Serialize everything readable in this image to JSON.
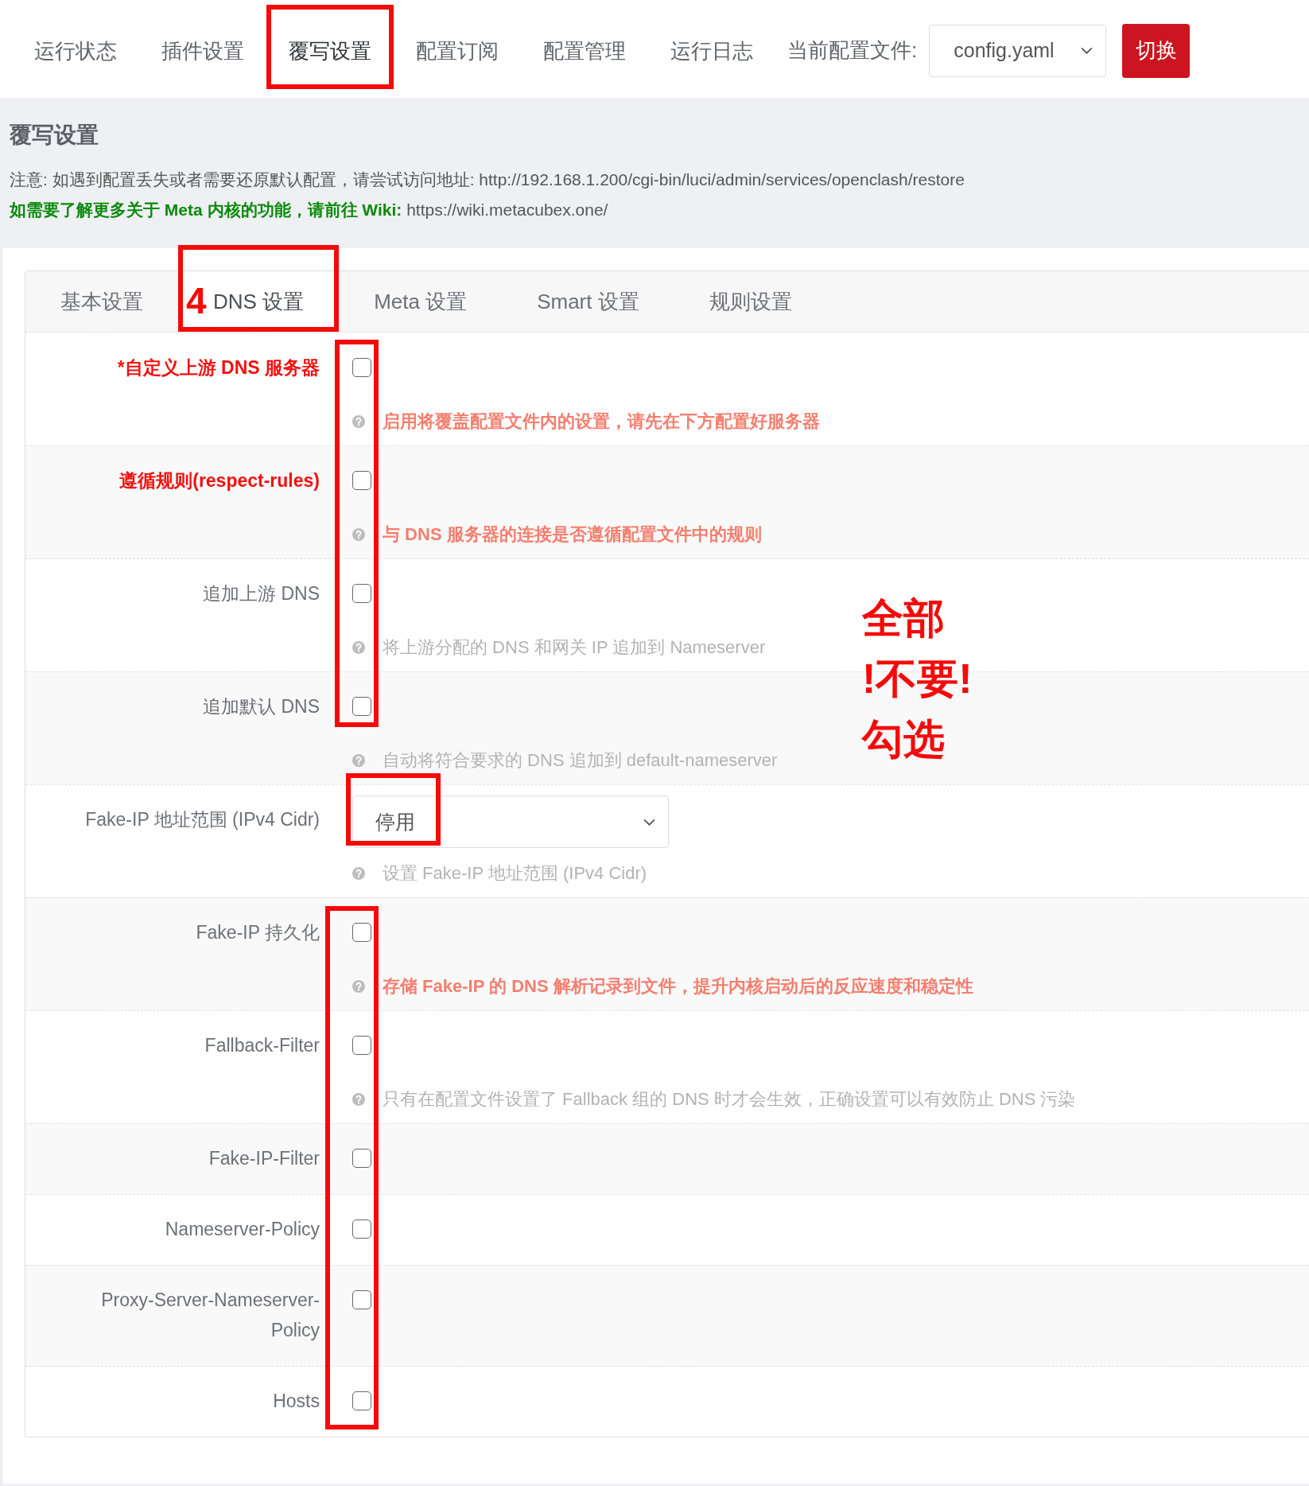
{
  "nav": {
    "tabs": [
      {
        "label": "运行状态",
        "selected": false
      },
      {
        "label": "插件设置",
        "selected": false
      },
      {
        "label": "覆写设置",
        "selected": true
      },
      {
        "label": "配置订阅",
        "selected": false
      },
      {
        "label": "配置管理",
        "selected": false
      },
      {
        "label": "运行日志",
        "selected": false
      }
    ],
    "config_label": "当前配置文件:",
    "config_select": {
      "value": "config.yaml"
    },
    "switch_button": "切换"
  },
  "section": {
    "title": "覆写设置",
    "notice": "注意: 如遇到配置丢失或者需要还原默认配置，请尝试访问地址: http://192.168.1.200/cgi-bin/luci/admin/services/openclash/restore",
    "wiki_note": "**如需要了解更多关于 Meta 内核的功能，请前往 Wiki:** https://wiki.metacubex.one/"
  },
  "subtabs": [
    {
      "label": "基本设置",
      "selected": false
    },
    {
      "label": "DNS 设置",
      "selected": true
    },
    {
      "label": "Meta 设置",
      "selected": false
    },
    {
      "label": "Smart 设置",
      "selected": false
    },
    {
      "label": "规则设置",
      "selected": false
    }
  ],
  "rows": [
    {
      "kind": "checkbox",
      "label": "*自定义上游 DNS 服务器",
      "emphasis": true,
      "checked": false,
      "help": {
        "text": "启用将覆盖配置文件内的设置，请先在下方配置好服务器",
        "warning": true
      }
    },
    {
      "kind": "checkbox",
      "label": "遵循规则(respect-rules)",
      "emphasis": true,
      "checked": false,
      "help": {
        "text": "与 DNS 服务器的连接是否遵循配置文件中的规则",
        "warning": true
      }
    },
    {
      "kind": "checkbox",
      "label": "追加上游 DNS",
      "emphasis": false,
      "checked": false,
      "help": {
        "text": "将上游分配的 DNS 和网关 IP 追加到 Nameserver",
        "warning": false
      }
    },
    {
      "kind": "checkbox",
      "label": "追加默认 DNS",
      "emphasis": false,
      "checked": false,
      "help": {
        "text": "自动将符合要求的 DNS 追加到 default-nameserver",
        "warning": false
      }
    },
    {
      "kind": "select",
      "label": "Fake-IP 地址范围 (IPv4 Cidr)",
      "emphasis": false,
      "value": "停用",
      "help": {
        "text": "设置 Fake-IP 地址范围 (IPv4 Cidr)",
        "warning": false
      }
    },
    {
      "kind": "checkbox",
      "label": "Fake-IP 持久化",
      "emphasis": false,
      "checked": false,
      "help": {
        "text": "存储 Fake-IP 的 DNS 解析记录到文件，提升内核启动后的反应速度和稳定性",
        "warning": true
      }
    },
    {
      "kind": "checkbox",
      "label": "Fallback-Filter",
      "emphasis": false,
      "checked": false,
      "help": {
        "text": "只有在配置文件设置了 Fallback 组的 DNS 时才会生效，正确设置可以有效防止 DNS 污染",
        "warning": false
      }
    },
    {
      "kind": "checkbox",
      "label": "Fake-IP-Filter",
      "emphasis": false,
      "checked": false
    },
    {
      "kind": "checkbox",
      "label": "Nameserver-Policy",
      "emphasis": false,
      "checked": false
    },
    {
      "kind": "checkbox",
      "label": "Proxy-Server-Nameserver-Policy",
      "emphasis": false,
      "checked": false
    },
    {
      "kind": "checkbox",
      "label": "Hosts",
      "emphasis": false,
      "checked": false
    }
  ],
  "annotation": {
    "step": "4",
    "note_lines": [
      "全部",
      "!不要!",
      "勾选"
    ]
  }
}
